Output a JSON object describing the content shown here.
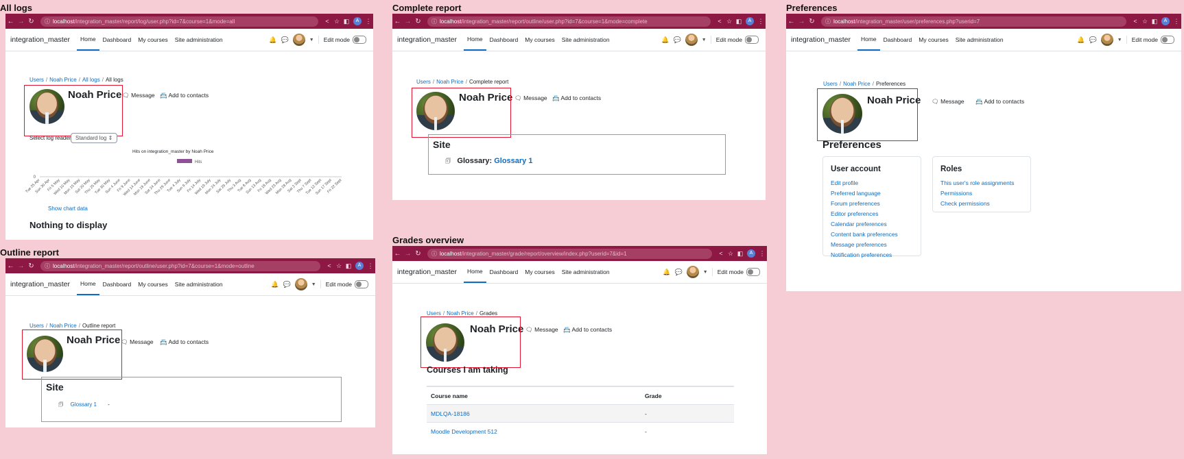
{
  "common": {
    "brand": "integration_master",
    "nav": [
      "Home",
      "Dashboard",
      "My courses",
      "Site administration"
    ],
    "edit_mode": "Edit mode",
    "user_name": "Noah Price",
    "message": "Message",
    "add_contacts": "Add to contacts",
    "crumb_users": "Users",
    "host": "localhost",
    "account_initial": "A"
  },
  "all_logs": {
    "title": "All logs",
    "url_path": "/integration_master/report/log/user.php?id=7&course=1&mode=all",
    "crumbs": [
      "Users",
      "Noah Price",
      "All logs",
      "All logs"
    ],
    "select_label": "Select log reader",
    "select_value": "Standard log",
    "chart_data": {
      "type": "bar",
      "title": "Hits on integration_master by Noah Price",
      "series": [
        {
          "name": "Hits",
          "values": [
            0,
            0,
            0,
            0,
            0,
            0,
            0,
            0,
            0,
            0,
            0,
            0,
            0,
            0,
            0,
            0,
            0,
            0,
            0,
            0,
            0,
            0,
            0,
            0,
            0,
            0,
            0,
            0,
            0,
            0
          ]
        }
      ],
      "categories": [
        "Tue 25 Apr",
        "Sun 30 Apr",
        "Fri 5 May",
        "Wed 10 May",
        "Mon 15 May",
        "Sat 20 May",
        "Thu 25 May",
        "Tue 30 May",
        "Sun 4 June",
        "Fri 9 June",
        "Wed 14 June",
        "Mon 19 June",
        "Sat 24 June",
        "Thu 29 June",
        "Tue 4 July",
        "Sun 9 July",
        "Fri 14 July",
        "Wed 19 July",
        "Mon 24 July",
        "Sat 29 July",
        "Thu 3 Aug",
        "Tue 8 Aug",
        "Sun 13 Aug",
        "Fri 18 Aug",
        "Wed 23 Aug",
        "Mon 28 Aug",
        "Sat 2 Sept",
        "Thu 7 Sept",
        "Tue 12 Sept",
        "Sun 17 Sept",
        "Fri 22 Sept"
      ],
      "ytick": "0",
      "legend_color": "#8e5196"
    },
    "show_chart_data": "Show chart data",
    "nothing": "Nothing to display"
  },
  "outline": {
    "title": "Outline report",
    "url_path": "/integration_master/report/outline/user.php?id=7&course=1&mode=outline",
    "crumbs": [
      "Users",
      "Noah Price",
      "Outline report"
    ],
    "section": "Site",
    "item": "Glossary 1",
    "dash": "-"
  },
  "complete": {
    "title": "Complete report",
    "url_path": "/integration_master/report/outline/user.php?id=7&course=1&mode=complete",
    "crumbs": [
      "Users",
      "Noah Price",
      "Complete report"
    ],
    "section": "Site",
    "item_label": "Glossary:",
    "item_link": "Glossary 1"
  },
  "grades": {
    "title": "Grades overview",
    "url_path": "/integration_master/grade/report/overview/index.php?userid=7&id=1",
    "crumbs": [
      "Users",
      "Noah Price",
      "Grades"
    ],
    "heading": "Courses I am taking",
    "col_course": "Course name",
    "col_grade": "Grade",
    "rows": [
      {
        "course": "MDLQA-18186",
        "grade": "-"
      },
      {
        "course": "Moodle Development 512",
        "grade": "-"
      }
    ]
  },
  "preferences": {
    "title": "Preferences",
    "url_path": "/integration_master/user/preferences.php?userid=7",
    "crumbs": [
      "Users",
      "Noah Price",
      "Preferences"
    ],
    "heading": "Preferences",
    "user_account": {
      "title": "User account",
      "links": [
        "Edit profile",
        "Preferred language",
        "Forum preferences",
        "Editor preferences",
        "Calendar preferences",
        "Content bank preferences",
        "Message preferences",
        "Notification preferences"
      ]
    },
    "roles": {
      "title": "Roles",
      "links": [
        "This user's role assignments",
        "Permissions",
        "Check permissions"
      ]
    }
  }
}
